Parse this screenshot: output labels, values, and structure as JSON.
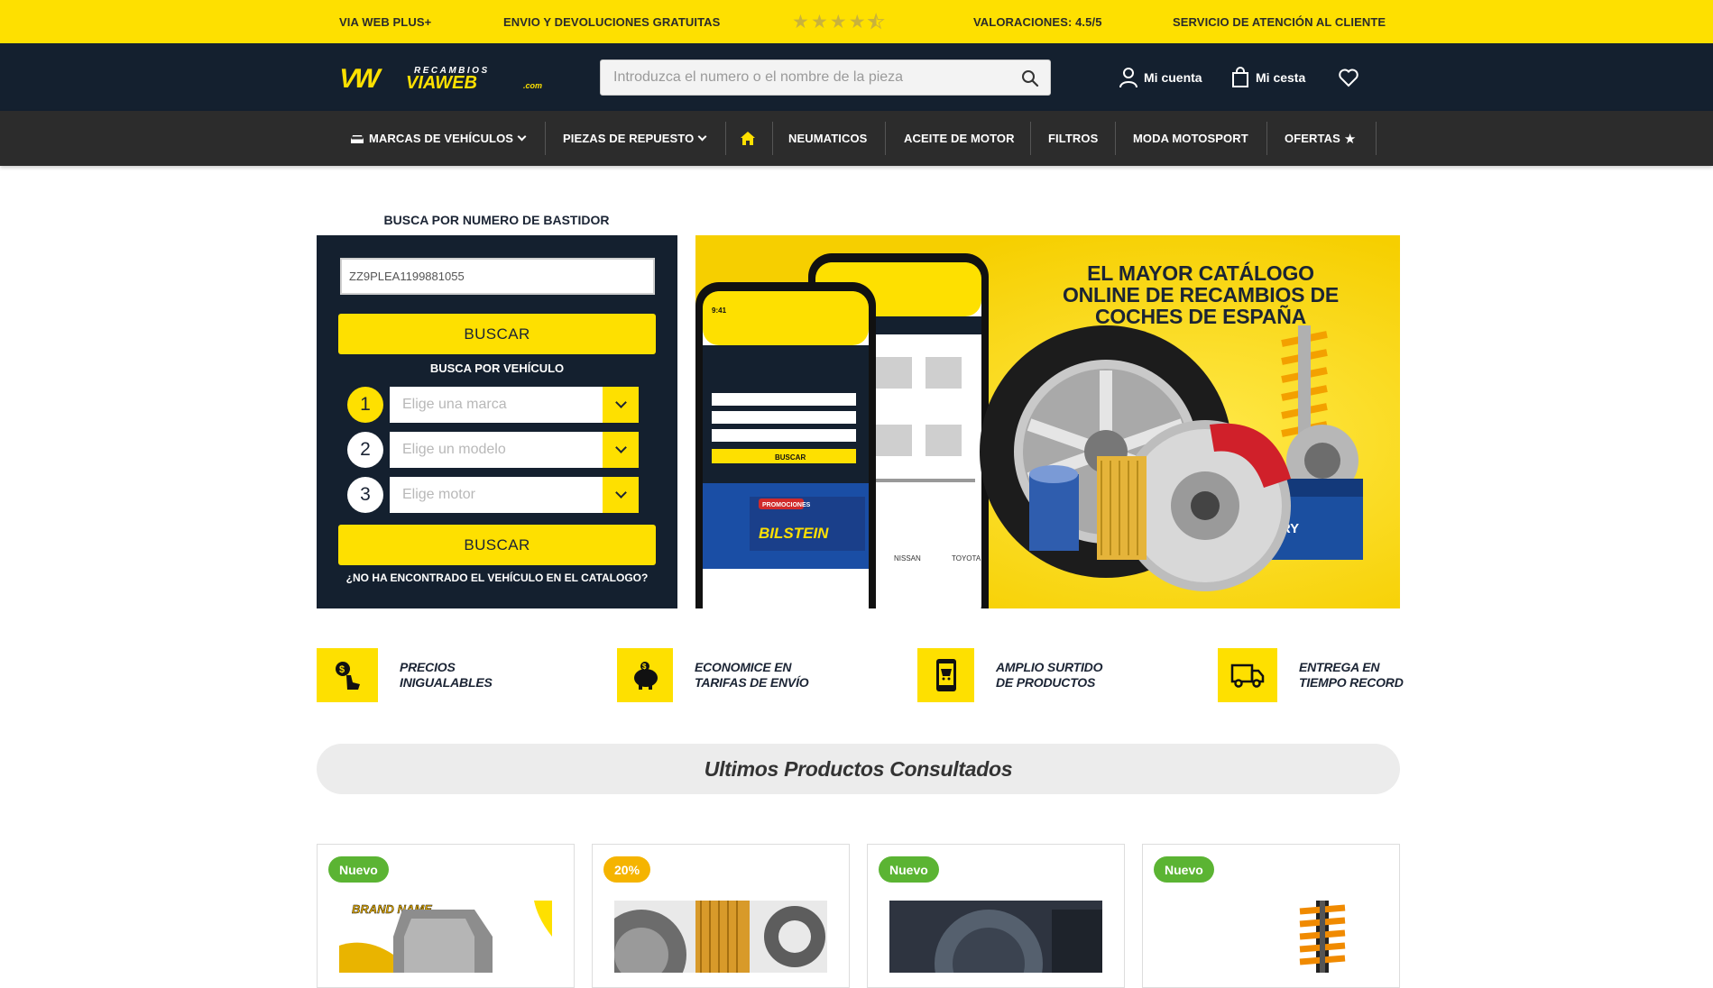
{
  "topbar": {
    "items": [
      "VIA WEB PLUS+",
      "ENVIO Y DEVOLUCIONES GRATUITAS",
      "VALORACIONES: 4.5/5",
      "SERVICIO DE ATENCIÓN AL CLIENTE"
    ],
    "rating": 4.5,
    "rating_max": 5,
    "background": "#fee000"
  },
  "header": {
    "logo_text": "VIAWEB",
    "logo_sub": "RECAMBIOS",
    "logo_com": ".com",
    "search_placeholder": "Introduzca el numero o el nombre de la pieza",
    "account_label": "Mi cuenta",
    "cart_label": "Mi cesta",
    "background": "#14202f"
  },
  "nav": {
    "items": [
      "MARCAS DE VEHÍCULOS",
      "PIEZAS DE REPUESTO",
      "NEUMATICOS",
      "ACEITE DE MOTOR",
      "FILTROS",
      "MODA MOTOSPORT",
      "OFERTAS"
    ]
  },
  "search_panel": {
    "title": "BUSCA POR NUMERO DE BASTIDOR",
    "vin_value": "ZZ9PLEA1199881055",
    "search_button": "BUSCAR",
    "vehicle_title": "BUSCA POR VEHÍCULO",
    "steps": [
      {
        "number": "1",
        "placeholder": "Elige una marca"
      },
      {
        "number": "2",
        "placeholder": "Elige un modelo"
      },
      {
        "number": "3",
        "placeholder": "Elige motor"
      }
    ],
    "search_button_2": "BUSCAR",
    "not_found": "¿NO HA ENCONTRADO EL VEHÍCULO EN EL CATALOGO?"
  },
  "hero": {
    "headline": [
      "EL MAYOR CATÁLOGO",
      "ONLINE DE RECAMBIOS DE",
      "COCHES DE ESPAÑA"
    ],
    "phone_brand": "BILSTEIN",
    "battery_label": "BATTERY",
    "phone_time": "9:41",
    "phone_labels": [
      "BUSCAR",
      "PROMOCIONES",
      "NISSAN",
      "TOYOTA"
    ]
  },
  "features": [
    {
      "line1": "PRECIOS",
      "line2": "INIGUALABLES",
      "icon": "price-hand-icon"
    },
    {
      "line1": "ECONOMICE EN",
      "line2": "TARIFAS DE ENVÍO",
      "icon": "piggy-bank-icon"
    },
    {
      "line1": "AMPLIO SURTIDO",
      "line2": "DE PRODUCTOS",
      "icon": "mobile-cart-icon"
    },
    {
      "line1": "ENTREGA EN",
      "line2": "TIEMPO RECORD",
      "icon": "delivery-truck-icon"
    }
  ],
  "last_viewed": {
    "title": "Ultimos Productos Consultados",
    "products": [
      {
        "badge": "Nuevo",
        "badge_color": "#5bb433",
        "image_text": "BRAND NAME"
      },
      {
        "badge": "20%",
        "badge_color": "#f5b400"
      },
      {
        "badge": "Nuevo",
        "badge_color": "#5bb433"
      },
      {
        "badge": "Nuevo",
        "badge_color": "#5bb433"
      }
    ]
  }
}
